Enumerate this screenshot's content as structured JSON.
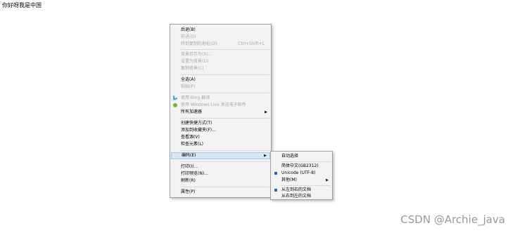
{
  "page": {
    "text": "你好呀我是中国"
  },
  "context_menu": {
    "items": [
      {
        "label": "后退(B)",
        "disabled": false
      },
      {
        "label": "前进(O)",
        "disabled": true
      },
      {
        "label": "转到复制的地址(D)",
        "shortcut": "Ctrl+Shift+L",
        "disabled": true
      },
      {
        "label": "背景另存为(S)...",
        "disabled": true
      },
      {
        "label": "设置为背景(G)",
        "disabled": true
      },
      {
        "label": "复制背景(C)",
        "disabled": true
      },
      {
        "label": "全选(A)",
        "disabled": false
      },
      {
        "label": "粘贴(P)",
        "disabled": true
      },
      {
        "label": "使用 Bing 翻译",
        "disabled": true,
        "icon": "bing-icon"
      },
      {
        "label": "使用 Windows Live 发送电子邮件",
        "disabled": true,
        "icon": "windows-live-icon"
      },
      {
        "label": "所有加速器",
        "disabled": false,
        "submenu": true
      },
      {
        "label": "创建快捷方式(T)",
        "disabled": false
      },
      {
        "label": "添加到收藏夹(F)...",
        "disabled": false
      },
      {
        "label": "查看源(V)",
        "disabled": false
      },
      {
        "label": "检查元素(L)",
        "disabled": false
      },
      {
        "label": "编码(E)",
        "disabled": false,
        "submenu": true,
        "highlighted": true
      },
      {
        "label": "打印(I)...",
        "disabled": false
      },
      {
        "label": "打印预览(N)...",
        "disabled": false
      },
      {
        "label": "刷新(R)",
        "disabled": false
      },
      {
        "label": "属性(P)",
        "disabled": false
      }
    ]
  },
  "encoding_submenu": {
    "items": [
      {
        "label": "自动选择",
        "selected": false
      },
      {
        "label": "简体中文(GB2312)",
        "selected": false
      },
      {
        "label": "Unicode (UTF-8)",
        "selected": true
      },
      {
        "label": "其他(M)",
        "selected": false,
        "submenu": true
      },
      {
        "label": "从左到右的文档",
        "selected": true
      },
      {
        "label": "从右到左的文档",
        "selected": false
      }
    ]
  },
  "watermark": "CSDN @Archie_java",
  "colors": {
    "menu_bg": "#f3f3f3",
    "highlight": "#d6e6f7",
    "disabled_text": "#a8a8a8",
    "radio_dot": "#2a5fb0"
  }
}
